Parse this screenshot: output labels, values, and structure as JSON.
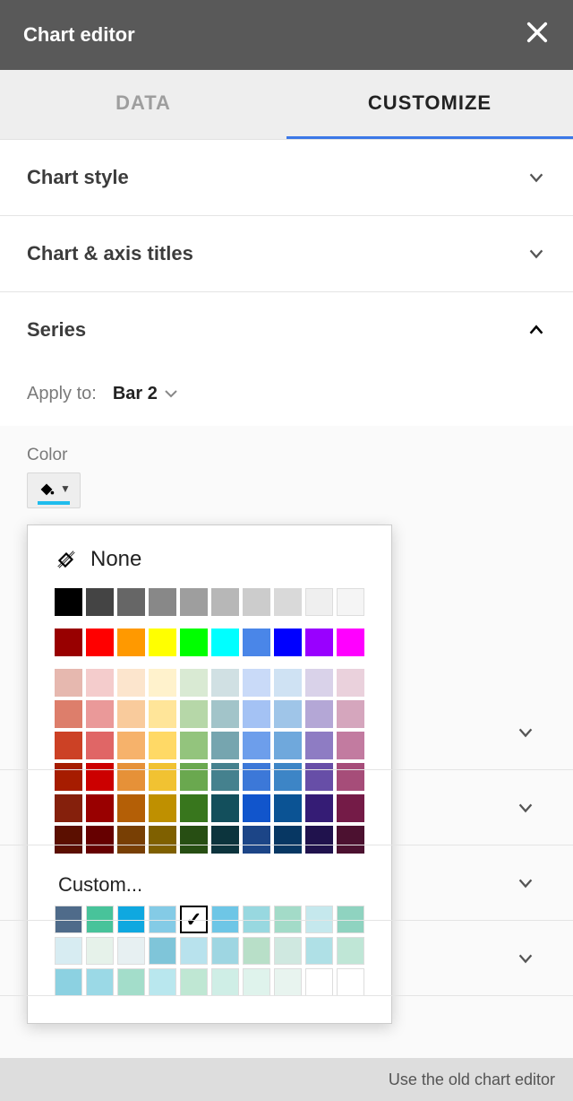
{
  "header": {
    "title": "Chart editor"
  },
  "tabs": {
    "data": "DATA",
    "customize": "CUSTOMIZE",
    "active": "customize"
  },
  "sections": {
    "chart_style": {
      "label": "Chart style"
    },
    "chart_axis_titles": {
      "label": "Chart & axis titles"
    },
    "series": {
      "label": "Series",
      "apply_label": "Apply to:",
      "apply_value": "Bar 2",
      "color_label": "Color"
    }
  },
  "color_picker": {
    "none_label": "None",
    "custom_label": "Custom...",
    "grayscale": [
      "#000000",
      "#444444",
      "#666666",
      "#888888",
      "#9e9e9e",
      "#b7b7b7",
      "#cccccc",
      "#d9d9d9",
      "#efefef",
      "#f5f5f5"
    ],
    "brights": [
      "#980000",
      "#ff0000",
      "#ff9900",
      "#ffff00",
      "#00ff00",
      "#00ffff",
      "#4a86e8",
      "#0000ff",
      "#9900ff",
      "#ff00ff"
    ],
    "shade_rows": [
      [
        "#e6b8af",
        "#f4cccc",
        "#fce5cd",
        "#fff2cc",
        "#d9ead3",
        "#d0e0e3",
        "#c9daf8",
        "#cfe2f3",
        "#d9d2e9",
        "#ead1dc"
      ],
      [
        "#dd7e6b",
        "#ea9999",
        "#f9cb9c",
        "#ffe599",
        "#b6d7a8",
        "#a2c4c9",
        "#a4c2f4",
        "#9fc5e8",
        "#b4a7d6",
        "#d5a6bd"
      ],
      [
        "#cc4125",
        "#e06666",
        "#f6b26b",
        "#ffd966",
        "#93c47d",
        "#76a5af",
        "#6d9eeb",
        "#6fa8dc",
        "#8e7cc3",
        "#c27ba0"
      ],
      [
        "#a61c00",
        "#cc0000",
        "#e69138",
        "#f1c232",
        "#6aa84f",
        "#45818e",
        "#3c78d8",
        "#3d85c6",
        "#674ea7",
        "#a64d79"
      ],
      [
        "#85200c",
        "#990000",
        "#b45f06",
        "#bf9000",
        "#38761d",
        "#134f5c",
        "#1155cc",
        "#0b5394",
        "#351c75",
        "#741b47"
      ],
      [
        "#5b0f00",
        "#660000",
        "#783f04",
        "#7f6000",
        "#274e13",
        "#0c343d",
        "#1c4587",
        "#073763",
        "#20124d",
        "#4c1130"
      ]
    ],
    "custom_rows": [
      [
        "#4f6b8a",
        "#48c39a",
        "#0fa8e0",
        "#84cbe6",
        "#ffffff",
        "#6ec6e6",
        "#98d8e0",
        "#a3dbc8",
        "#c5e8ed",
        "#8fd3c0"
      ],
      [
        "#d7ecf2",
        "#e6f2ea",
        "#e7f0f2",
        "#7fc5d9",
        "#b8e2ed",
        "#9ed6e2",
        "#b8dfc8",
        "#cfe8e0",
        "#afe0e6",
        "#bfe6d6"
      ],
      [
        "#8cd1e1",
        "#9bd9e6",
        "#a3ddca",
        "#b9e7ee",
        "#bfe7d3",
        "#cfeee6",
        "#dff3ec",
        "#e8f4ef",
        "#ffffff",
        "#ffffff"
      ]
    ],
    "selected_custom": {
      "row": 0,
      "col": 4
    }
  },
  "footer": {
    "link": "Use the old chart editor"
  }
}
